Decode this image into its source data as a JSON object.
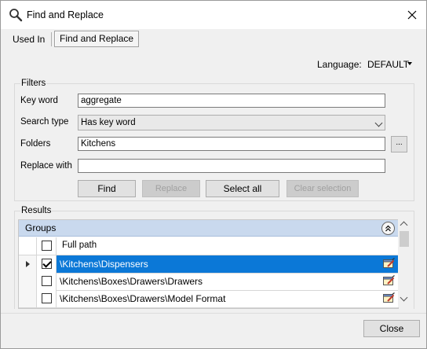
{
  "window": {
    "title": "Find and Replace"
  },
  "tabs": [
    {
      "label": "Used In"
    },
    {
      "label": "Find and Replace"
    }
  ],
  "language": {
    "label": "Language:",
    "value": "DEFAULT"
  },
  "filters": {
    "group_label": "Filters",
    "keyword_label": "Key word",
    "keyword_value": "aggregate",
    "search_type_label": "Search type",
    "search_type_value": "Has key word",
    "folders_label": "Folders",
    "folders_value": "Kitchens",
    "browse_label": "...",
    "replace_label": "Replace with",
    "replace_value": "",
    "buttons": {
      "find": "Find",
      "replace": "Replace",
      "select_all": "Select all",
      "clear_selection": "Clear selection"
    }
  },
  "results": {
    "group_label": "Results",
    "groups_header": "Groups",
    "column_header": "Full path",
    "rows": [
      {
        "path": "\\Kitchens\\Dispensers",
        "checked": true,
        "selected": true
      },
      {
        "path": "\\Kitchens\\Boxes\\Drawers\\Drawers",
        "checked": false,
        "selected": false
      },
      {
        "path": "\\Kitchens\\Boxes\\Drawers\\Model Format",
        "checked": false,
        "selected": false
      }
    ]
  },
  "footer": {
    "close_label": "Close"
  },
  "colors": {
    "selection": "#0b78d7",
    "groups_header": "#c9d9ee"
  },
  "icons": {
    "title": "search-icon",
    "row_action": "edit-icon"
  }
}
